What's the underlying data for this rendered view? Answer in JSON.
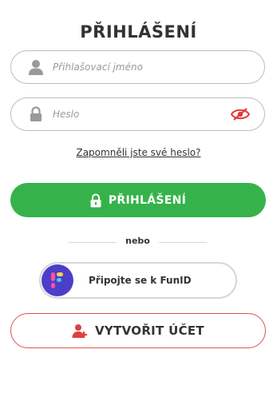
{
  "title": "PŘIHLÁŠENÍ",
  "username": {
    "placeholder": "Přihlašovací jméno",
    "value": "",
    "icon": "user-icon"
  },
  "password": {
    "placeholder": "Heslo",
    "value": "",
    "icon": "lock-icon",
    "toggle_icon": "eye-slash-icon"
  },
  "forgot_link": "Zapomněli jste své heslo?",
  "login_button": {
    "label": "PŘIHLÁŠENÍ",
    "icon": "lock-icon",
    "color": "#35b34a"
  },
  "divider_text": "nebo",
  "funid_button": {
    "label": "Připojte se k FunID",
    "icon": "funid-logo"
  },
  "create_account_button": {
    "label": "VYTVOŘIT ÚČET",
    "icon": "add-user-icon",
    "accent": "#e04040"
  }
}
